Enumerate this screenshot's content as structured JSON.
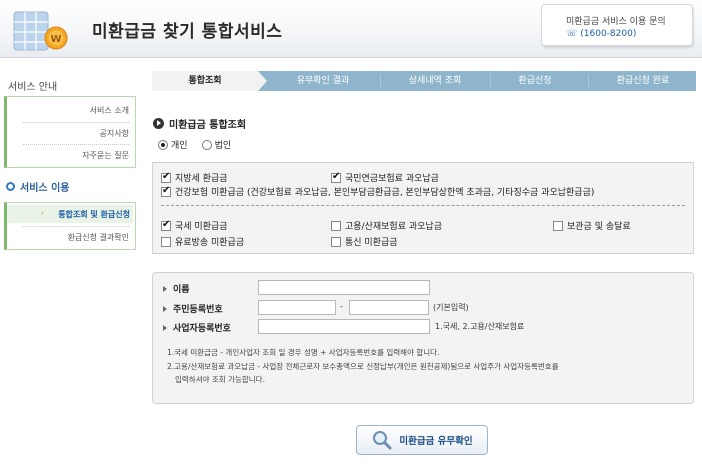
{
  "header": {
    "title": "미환급금 찾기 통합서비스",
    "contact_label": "미환급금 서비스 이용 문의",
    "contact_phone": "(1600-8200)",
    "phone_icon": "☏"
  },
  "sidebar": {
    "section1_title": "서비스 안내",
    "items1": [
      "서비스 소개",
      "공지사항",
      "자주묻는 질문"
    ],
    "section2_title": "서비스 이용",
    "items2": [
      "통합조회 및 환급신청",
      "환급신청 결과확인"
    ]
  },
  "steps": [
    "통합조회",
    "유무확인 결과",
    "상세내역 조회",
    "환급신청",
    "환급신청 완료"
  ],
  "section_title": "미환급금 통합조회",
  "radios": {
    "individual": "개인",
    "corporate": "법인",
    "selected": "individual"
  },
  "checkboxes": {
    "local_tax": "지방세 환급금",
    "national_pension": "국민연금보험료 과오납금",
    "health_insurance": "건강보험 미환급금 (건강보험료 과오납금, 본인부담금환급금, 본인부담상한액 초과금, 기타징수금 과오납환급금)",
    "national_tax": "국세 미환급금",
    "employment_insurance": "고용/산재보험료 과오납금",
    "deposit_fee": "보관금 및 송달료",
    "broadcasting_fee": "유료방송 미환급금",
    "telecom": "통신 미환급금"
  },
  "form": {
    "name_label": "이름",
    "rrn_label": "주민등록번호",
    "rrn_separator": "-",
    "rrn_note": "(기본입력)",
    "brn_label": "사업자등록번호",
    "brn_note": "1.국세, 2.고용/산재보험료",
    "desc1": "1.국세 미환급금 - 개인사업자 조회 일 경우 성명 + 사업자등록번호를 입력해야 합니다.",
    "desc2a": "2.고용/산재보험료 과오납금 - 사업장 전체근로자 보수총액으로 신정납부(개인은 원천공제)됨으로 사업주가 사업자등록번호를",
    "desc2b": "입력하셔야 조회 가능합니다."
  },
  "confirm_button": "미환급금 유무확인"
}
